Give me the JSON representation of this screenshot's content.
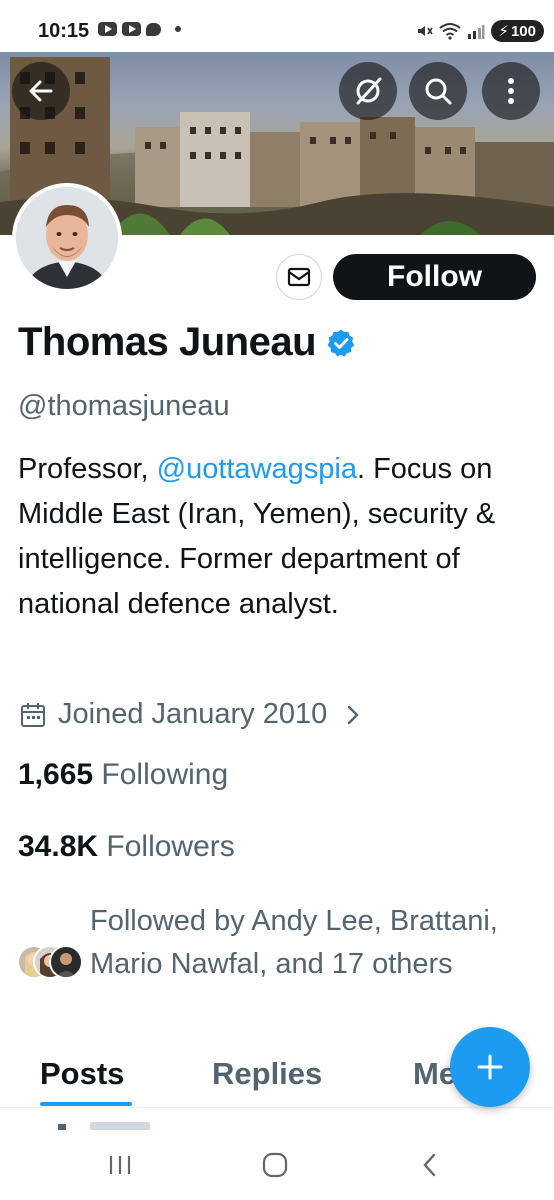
{
  "status_bar": {
    "time": "10:15",
    "battery": "100",
    "icons": [
      "youtube-icon",
      "youtube-icon",
      "chat-bubble-icon",
      "dot-icon",
      "mute-icon",
      "wifi-icon",
      "signal-icon",
      "battery-icon"
    ]
  },
  "header": {
    "icons": [
      "back-arrow-icon",
      "grok-icon",
      "search-icon",
      "more-vertical-icon"
    ]
  },
  "profile": {
    "display_name": "Thomas Juneau",
    "handle": "@thomasjuneau",
    "bio_prefix": "Professor, ",
    "bio_mention": "@uottawagspia",
    "bio_rest": ". Focus on Middle East (Iran, Yemen), security & intelligence. Former department of national defence analyst.",
    "joined": "Joined January 2010",
    "following_count": "1,665",
    "following_label": "Following",
    "followers_count": "34.8K",
    "followers_label": "Followers",
    "followed_by": "Followed by Andy Lee, Brattani, Mario Nawfal, and 17 others"
  },
  "actions": {
    "follow_label": "Follow"
  },
  "tabs": [
    {
      "label": "Posts",
      "active": true
    },
    {
      "label": "Replies",
      "active": false
    },
    {
      "label": "Media",
      "active": false
    }
  ],
  "colors": {
    "accent": "#1d9bf0",
    "text_primary": "#0f1419",
    "text_secondary": "#536471",
    "follow_bg": "#0f1419"
  }
}
